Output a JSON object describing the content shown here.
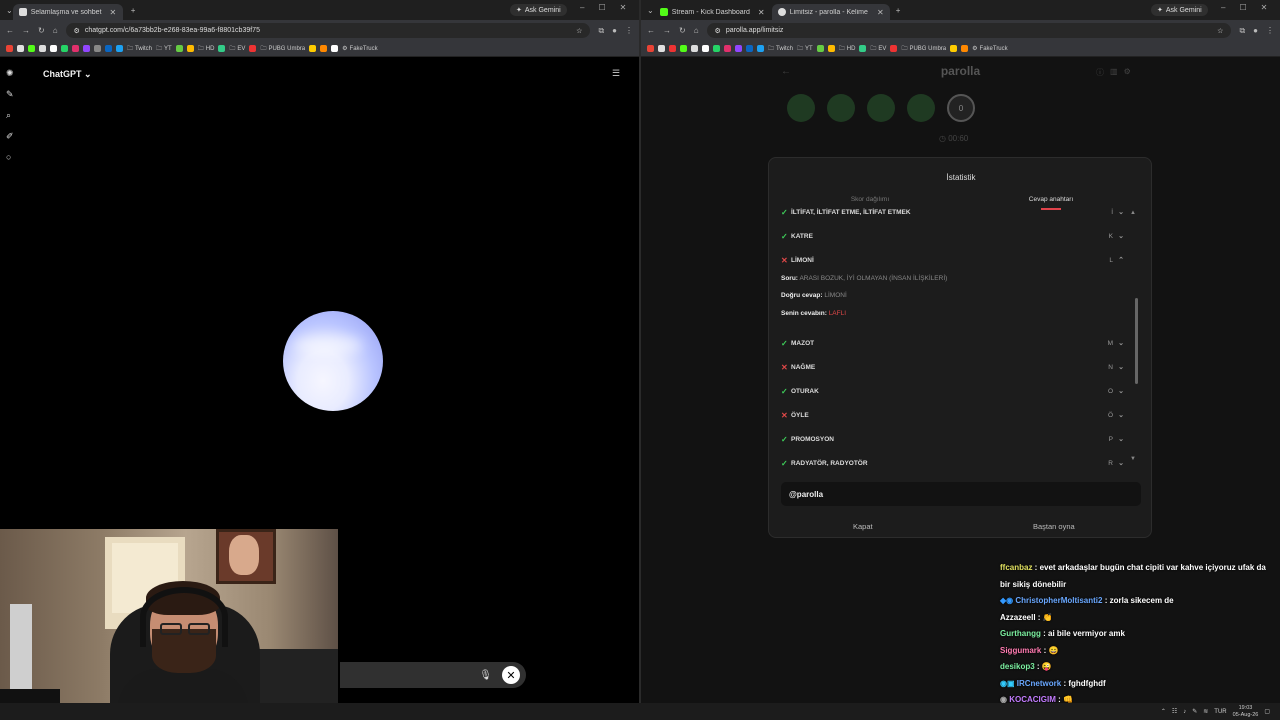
{
  "left_window": {
    "tab_title": "Selamlaşma ve sohbet",
    "gemini": "Ask Gemini",
    "url": "chatgpt.com/c/6a73bb2b-e268-83ea-99a6-f8801cb39f75",
    "bookmarks": [
      "Twitch",
      "YT",
      "HD",
      "EV",
      "PUBG Umbra",
      "FakeTruck"
    ],
    "app_title": "ChatGPT"
  },
  "right_window": {
    "tab1_title": "Stream - Kick Dashboard",
    "tab2_title": "Limitsiz - parolla - Kelime oyunu",
    "gemini": "Ask Gemini",
    "url": "parolla.app/limitsiz",
    "bookmarks": [
      "Twitch",
      "YT",
      "HD",
      "EV",
      "PUBG Umbra",
      "FakeTruck"
    ],
    "app_title": "parolla",
    "timer": "00:60",
    "modal": {
      "title": "İstatistik",
      "tab_score": "Skor dağılımı",
      "tab_answers": "Cevap anahtarı",
      "rows": [
        {
          "word": "İLTİFAT, İLTİFAT ETME, İLTİFAT ETMEK",
          "letter": "İ",
          "status": "ok"
        },
        {
          "word": "KATRE",
          "letter": "K",
          "status": "ok"
        },
        {
          "word": "LİMONİ",
          "letter": "L",
          "status": "no"
        },
        {
          "word": "MAZOT",
          "letter": "M",
          "status": "ok"
        },
        {
          "word": "NAĞME",
          "letter": "N",
          "status": "no"
        },
        {
          "word": "OTURAK",
          "letter": "O",
          "status": "ok"
        },
        {
          "word": "ÖYLE",
          "letter": "Ö",
          "status": "no"
        },
        {
          "word": "PROMOSYON",
          "letter": "P",
          "status": "ok"
        },
        {
          "word": "RADYATÖR, RADYOTÖR",
          "letter": "R",
          "status": "ok"
        }
      ],
      "detail": {
        "q_label": "Soru:",
        "q_text": "ARASI BOZUK, İYİ OLMAYAN (İNSAN İLİŞKİLERİ)",
        "a_label": "Doğru cevap:",
        "a_text": "LİMONİ",
        "y_label": "Senin cevabın:",
        "y_text": "LAFLI"
      },
      "brand": "@parolla",
      "close": "Kapat",
      "restart": "Baştan oyna"
    }
  },
  "chat": [
    {
      "user": "ffcanbaz",
      "msg": " : evet arkadaşlar bugün chat cipiti var kahve içiyoruz ufak da bir sikiş dönebilir",
      "color": "#e0e060"
    },
    {
      "user": "ChristopherMoltisanti2",
      "msg": " : zorla sikecem de",
      "color": "#6aa8ff"
    },
    {
      "user": "Azzazeell",
      "msg": " : 👏",
      "color": "#ffffff"
    },
    {
      "user": "Gurthangg",
      "msg": " : ai bile vermiyor amk",
      "color": "#7cf0a0"
    },
    {
      "user": "Siggumark",
      "msg": " : 😄",
      "color": "#ff7ab0"
    },
    {
      "user": "desikop3",
      "msg": " : 😜",
      "color": "#7cf0a0"
    },
    {
      "user": "IRCnetwork",
      "msg": " : fghdfghdf",
      "color": "#6aa8ff"
    },
    {
      "user": "KOCACIGIM",
      "msg": " : 👊",
      "color": "#c37cff"
    }
  ],
  "taskbar": {
    "lang": "TUR",
    "time": "19:03",
    "date": "05-Aug-26"
  }
}
